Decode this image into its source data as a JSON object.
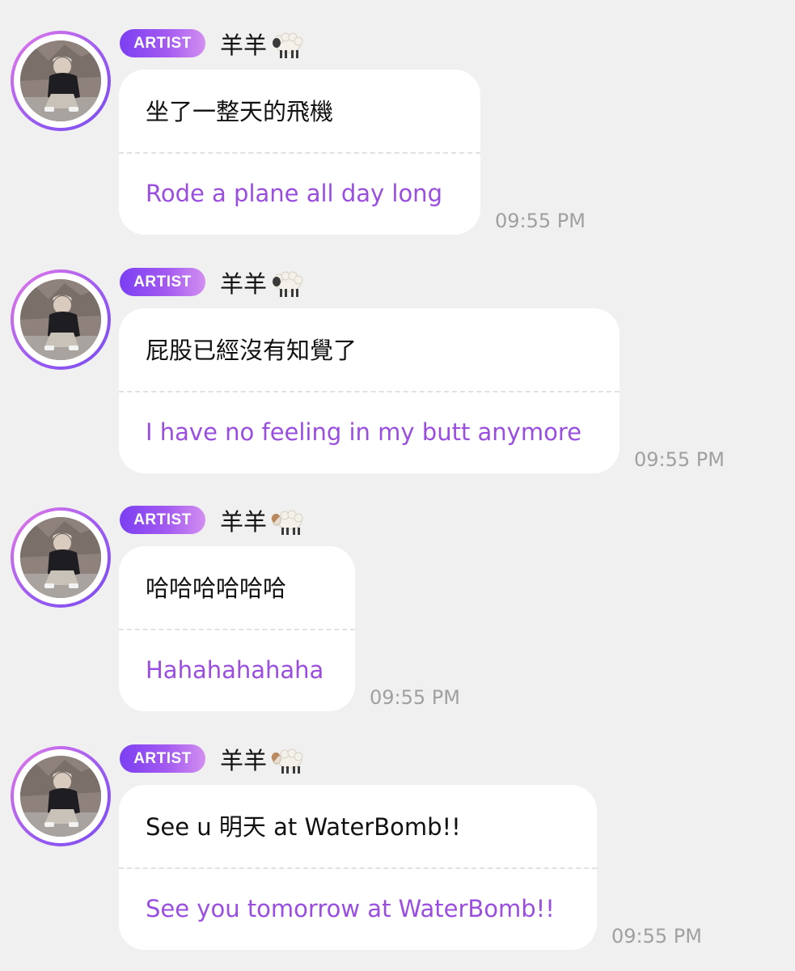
{
  "messages": [
    {
      "badge": "ARTIST",
      "sender": "羊羊",
      "sender_icon": "sheep-icon",
      "original": "坐了一整天的飛機",
      "translation": "Rode a plane all day long",
      "time": "09:55 PM"
    },
    {
      "badge": "ARTIST",
      "sender": "羊羊",
      "sender_icon": "sheep-icon",
      "original": "屁股已經沒有知覺了",
      "translation": "I have no feeling in my butt anymore",
      "time": "09:55 PM"
    },
    {
      "badge": "ARTIST",
      "sender": "羊羊",
      "sender_icon": "ram-icon",
      "original": "哈哈哈哈哈哈",
      "translation": "Hahahahahaha",
      "time": "09:55 PM"
    },
    {
      "badge": "ARTIST",
      "sender": "羊羊",
      "sender_icon": "ram-icon",
      "original": "See u 明天 at WaterBomb!!",
      "translation": "See you tomorrow at WaterBomb!!",
      "time": "09:55 PM"
    }
  ],
  "colors": {
    "background": "#f0f0f0",
    "bubble": "#ffffff",
    "translation_text": "#9a4ee0",
    "badge_gradient_start": "#7b3ff2",
    "badge_gradient_end": "#d38ff0",
    "timestamp": "#a0a0a0"
  }
}
